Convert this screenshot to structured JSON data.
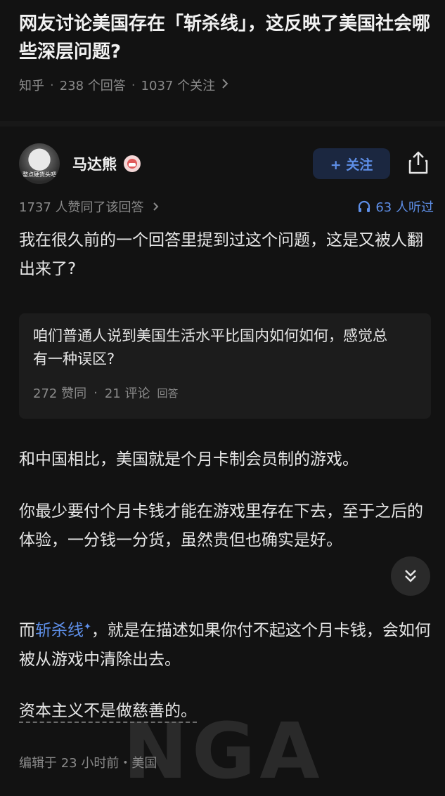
{
  "question": {
    "title": "网友讨论美国存在「斩杀线」，这反映了美国社会哪些深层问题?",
    "source": "知乎",
    "answers": "238 个回答",
    "followers": "1037 个关注"
  },
  "author": {
    "name": "马达熊",
    "avatar_text": "整点硬货头吧",
    "follow_label": "+ 关注"
  },
  "stats": {
    "likes_text": "1737 人赞同了该回答",
    "listen_text": "63 人听过"
  },
  "answer": {
    "p1": "我在很久前的一个回答里提到过这个问题，这是又被人翻出来了?",
    "quote_card": {
      "title": "咱们普通人说到美国生活水平比国内如何如何，感觉总有一种误区?",
      "votes": "272 赞同",
      "comments": "21 评论",
      "type": "回答"
    },
    "p2": "和中国相比，美国就是个月卡制会员制的游戏。",
    "p3": "你最少要付个月卡钱才能在游戏里存在下去，至于之后的体验，一分钱一分货，虽然贵但也确实是好。",
    "p4_prefix": "而",
    "p4_link": "斩杀线",
    "p4_suffix": "，就是在描述如果你付不起这个月卡钱，会如何被从游戏中清除出去。",
    "p5": "资本主义不是做慈善的。",
    "edited": "编辑于 23 小时前・美国"
  },
  "watermark": "NGA",
  "colors": {
    "background": "#121212",
    "accent": "#5e8fe8",
    "muted": "#8a8a8a"
  }
}
